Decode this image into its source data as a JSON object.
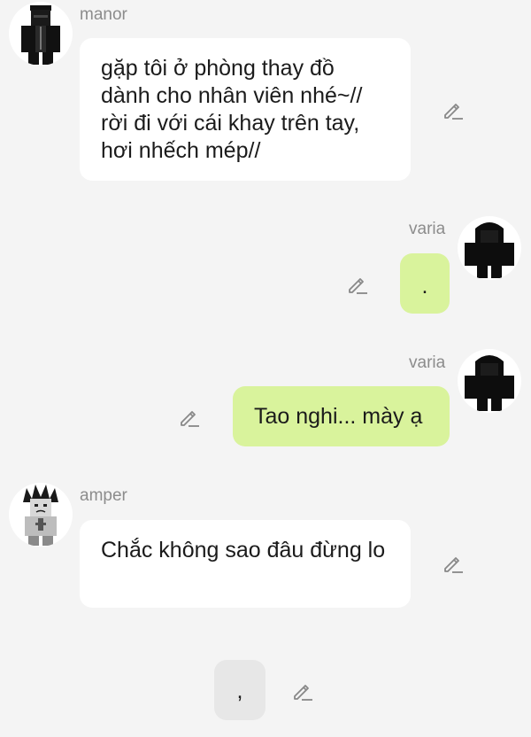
{
  "messages": [
    {
      "author": "manor",
      "avatar_icon": "masked-black-suit-avatar-icon",
      "text": "gặp tôi ở phòng thay đồ dành cho nhân viên nhé~// rời đi với cái khay trên tay, hơi nhếch mép//",
      "side": "left"
    },
    {
      "author": "varia",
      "avatar_icon": "dark-hooded-figure-avatar-icon",
      "text": ".",
      "side": "right"
    },
    {
      "author": "varia",
      "avatar_icon": "dark-hooded-figure-avatar-icon",
      "text": "Tao nghi... mày ạ",
      "side": "right"
    },
    {
      "author": "amper",
      "avatar_icon": "spiky-hair-character-avatar-icon",
      "text": "Chắc không sao đâu đừng lo",
      "side": "left"
    },
    {
      "author": "",
      "text": ",",
      "side": "draft"
    }
  ],
  "icons": {
    "edit": "pencil-edit-icon"
  },
  "colors": {
    "background": "#f4f4f4",
    "other_bubble": "#ffffff",
    "my_bubble": "#d9f39c",
    "draft_bubble": "#e7e7e7",
    "username": "#8c8c8c"
  }
}
